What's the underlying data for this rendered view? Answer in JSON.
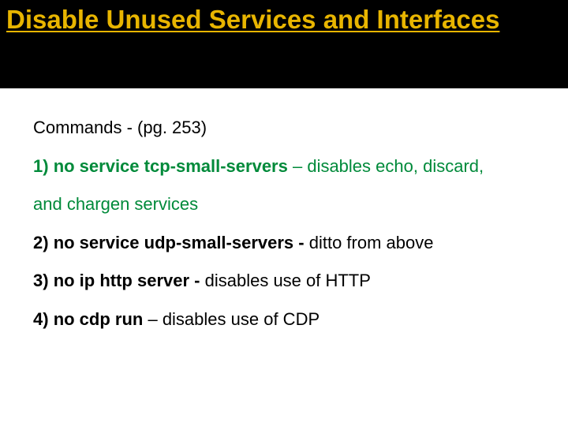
{
  "title": "Disable Unused Services and Interfaces",
  "intro": "Commands -  (pg. 253)",
  "items": [
    {
      "num": "1)",
      "cmd": "no service tcp-small-servers",
      "sep": " – ",
      "desc_a": "disables  echo, discard,",
      "desc_b": "and chargen services"
    },
    {
      "num": "2)",
      "cmd": "no service udp-small-servers",
      "sep": "  -  ",
      "desc_a": "ditto from above",
      "desc_b": ""
    },
    {
      "num": "3)",
      "cmd": "no ip http server",
      "sep": "  -  ",
      "desc_a": "disables use of HTTP",
      "desc_b": ""
    },
    {
      "num": "4)",
      "cmd": "no cdp run",
      "sep": " – ",
      "desc_a": "disables use of CDP",
      "desc_b": ""
    }
  ]
}
